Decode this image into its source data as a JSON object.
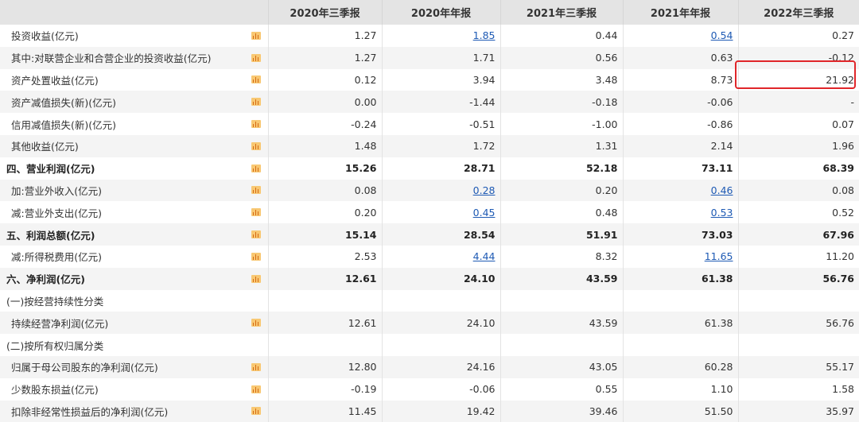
{
  "header": [
    "",
    "2020年三季报",
    "2020年年报",
    "2021年三季报",
    "2021年年报",
    "2022年三季报"
  ],
  "rows": [
    {
      "label": "投资收益(亿元)",
      "type": "normal",
      "icon": true,
      "values": [
        "1.27",
        "1.85",
        "0.44",
        "0.54",
        "0.27"
      ],
      "links": [
        false,
        true,
        false,
        true,
        false
      ]
    },
    {
      "label": "其中:对联营企业和合营企业的投资收益(亿元)",
      "type": "normal",
      "icon": true,
      "values": [
        "1.27",
        "1.71",
        "0.56",
        "0.63",
        "-0.12"
      ],
      "links": [
        false,
        false,
        false,
        false,
        false
      ]
    },
    {
      "label": "资产处置收益(亿元)",
      "type": "normal",
      "icon": true,
      "values": [
        "0.12",
        "3.94",
        "3.48",
        "8.73",
        "21.92"
      ],
      "links": [
        false,
        false,
        false,
        false,
        false
      ]
    },
    {
      "label": "资产减值损失(新)(亿元)",
      "type": "normal",
      "icon": true,
      "values": [
        "0.00",
        "-1.44",
        "-0.18",
        "-0.06",
        "-"
      ],
      "links": [
        false,
        false,
        false,
        false,
        false
      ]
    },
    {
      "label": "信用减值损失(新)(亿元)",
      "type": "normal",
      "icon": true,
      "values": [
        "-0.24",
        "-0.51",
        "-1.00",
        "-0.86",
        "0.07"
      ],
      "links": [
        false,
        false,
        false,
        false,
        false
      ]
    },
    {
      "label": "其他收益(亿元)",
      "type": "normal",
      "icon": true,
      "values": [
        "1.48",
        "1.72",
        "1.31",
        "2.14",
        "1.96"
      ],
      "links": [
        false,
        false,
        false,
        false,
        false
      ]
    },
    {
      "label": "四、营业利润(亿元)",
      "type": "bold",
      "icon": true,
      "values": [
        "15.26",
        "28.71",
        "52.18",
        "73.11",
        "68.39"
      ],
      "links": [
        false,
        false,
        false,
        false,
        false
      ]
    },
    {
      "label": "加:营业外收入(亿元)",
      "type": "normal",
      "icon": true,
      "values": [
        "0.08",
        "0.28",
        "0.20",
        "0.46",
        "0.08"
      ],
      "links": [
        false,
        true,
        false,
        true,
        false
      ]
    },
    {
      "label": "减:营业外支出(亿元)",
      "type": "normal",
      "icon": true,
      "values": [
        "0.20",
        "0.45",
        "0.48",
        "0.53",
        "0.52"
      ],
      "links": [
        false,
        true,
        false,
        true,
        false
      ]
    },
    {
      "label": "五、利润总额(亿元)",
      "type": "bold",
      "icon": true,
      "values": [
        "15.14",
        "28.54",
        "51.91",
        "73.03",
        "67.96"
      ],
      "links": [
        false,
        false,
        false,
        false,
        false
      ]
    },
    {
      "label": "减:所得税费用(亿元)",
      "type": "normal",
      "icon": true,
      "values": [
        "2.53",
        "4.44",
        "8.32",
        "11.65",
        "11.20"
      ],
      "links": [
        false,
        true,
        false,
        true,
        false
      ]
    },
    {
      "label": "六、净利润(亿元)",
      "type": "bold",
      "icon": true,
      "values": [
        "12.61",
        "24.10",
        "43.59",
        "61.38",
        "56.76"
      ],
      "links": [
        false,
        false,
        false,
        false,
        false
      ]
    },
    {
      "label": "(一)按经营持续性分类",
      "type": "section",
      "icon": false,
      "values": [
        "",
        "",
        "",
        "",
        ""
      ],
      "links": [
        false,
        false,
        false,
        false,
        false
      ]
    },
    {
      "label": "持续经营净利润(亿元)",
      "type": "indent",
      "icon": true,
      "values": [
        "12.61",
        "24.10",
        "43.59",
        "61.38",
        "56.76"
      ],
      "links": [
        false,
        false,
        false,
        false,
        false
      ]
    },
    {
      "label": "(二)按所有权归属分类",
      "type": "section",
      "icon": false,
      "values": [
        "",
        "",
        "",
        "",
        ""
      ],
      "links": [
        false,
        false,
        false,
        false,
        false
      ]
    },
    {
      "label": "归属于母公司股东的净利润(亿元)",
      "type": "indent",
      "icon": true,
      "values": [
        "12.80",
        "24.16",
        "43.05",
        "60.28",
        "55.17"
      ],
      "links": [
        false,
        false,
        false,
        false,
        false
      ]
    },
    {
      "label": "少数股东损益(亿元)",
      "type": "indent",
      "icon": true,
      "values": [
        "-0.19",
        "-0.06",
        "0.55",
        "1.10",
        "1.58"
      ],
      "links": [
        false,
        false,
        false,
        false,
        false
      ]
    },
    {
      "label": "扣除非经常性损益后的净利润(亿元)",
      "type": "indent",
      "icon": true,
      "values": [
        "11.45",
        "19.42",
        "39.46",
        "51.50",
        "35.97"
      ],
      "links": [
        false,
        false,
        false,
        false,
        false
      ]
    }
  ],
  "highlight": {
    "color": "#e0262a",
    "value": "21.92"
  },
  "colors": {
    "header_bg": "#e4e4e4",
    "row_alt": "#f4f4f4",
    "link": "#1e5ab4",
    "icon": "#f8c873"
  }
}
